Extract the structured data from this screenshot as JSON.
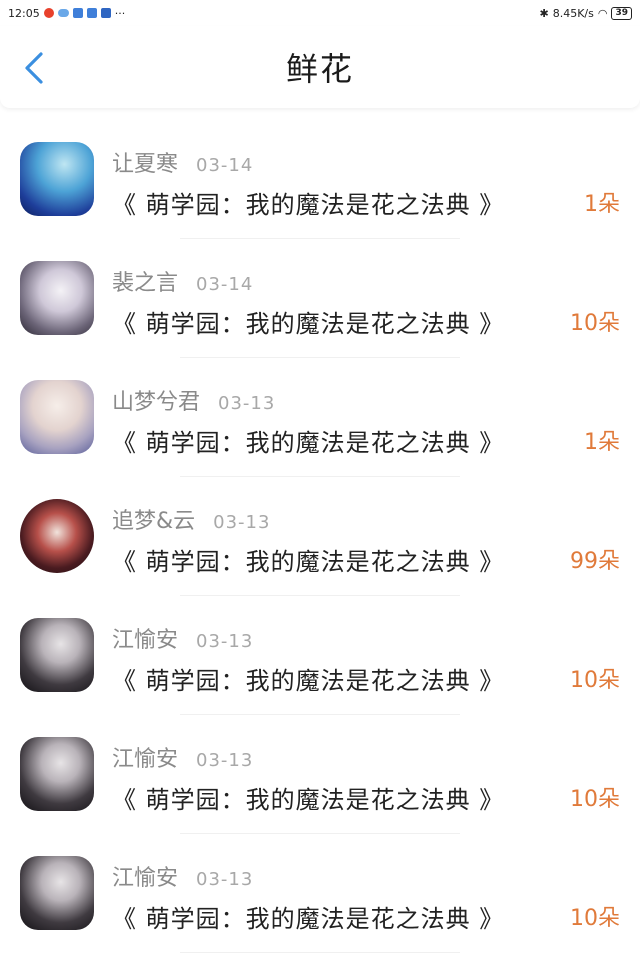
{
  "status_bar": {
    "time": "12:05",
    "dots": "···",
    "speed": "8.45K/s",
    "battery": "39"
  },
  "header": {
    "title": "鲜花",
    "back_icon": "chevron-left-icon",
    "accent_color": "#3b8fe0"
  },
  "flowers": [
    {
      "user": "让夏寒",
      "date": "03-14",
      "book": "《 萌学园：我的魔法是花之法典 》",
      "count": "1朵"
    },
    {
      "user": "裴之言",
      "date": "03-14",
      "book": "《 萌学园：我的魔法是花之法典 》",
      "count": "10朵"
    },
    {
      "user": "山梦兮君",
      "date": "03-13",
      "book": "《 萌学园：我的魔法是花之法典 》",
      "count": "1朵"
    },
    {
      "user": "追梦&云",
      "date": "03-13",
      "book": "《 萌学园：我的魔法是花之法典 》",
      "count": "99朵"
    },
    {
      "user": "江愉安",
      "date": "03-13",
      "book": "《 萌学园：我的魔法是花之法典 》",
      "count": "10朵"
    },
    {
      "user": "江愉安",
      "date": "03-13",
      "book": "《 萌学园：我的魔法是花之法典 》",
      "count": "10朵"
    },
    {
      "user": "江愉安",
      "date": "03-13",
      "book": "《 萌学园：我的魔法是花之法典 》",
      "count": "10朵"
    }
  ],
  "colors": {
    "count": "#e07a3a",
    "username": "#8a8a8a"
  }
}
